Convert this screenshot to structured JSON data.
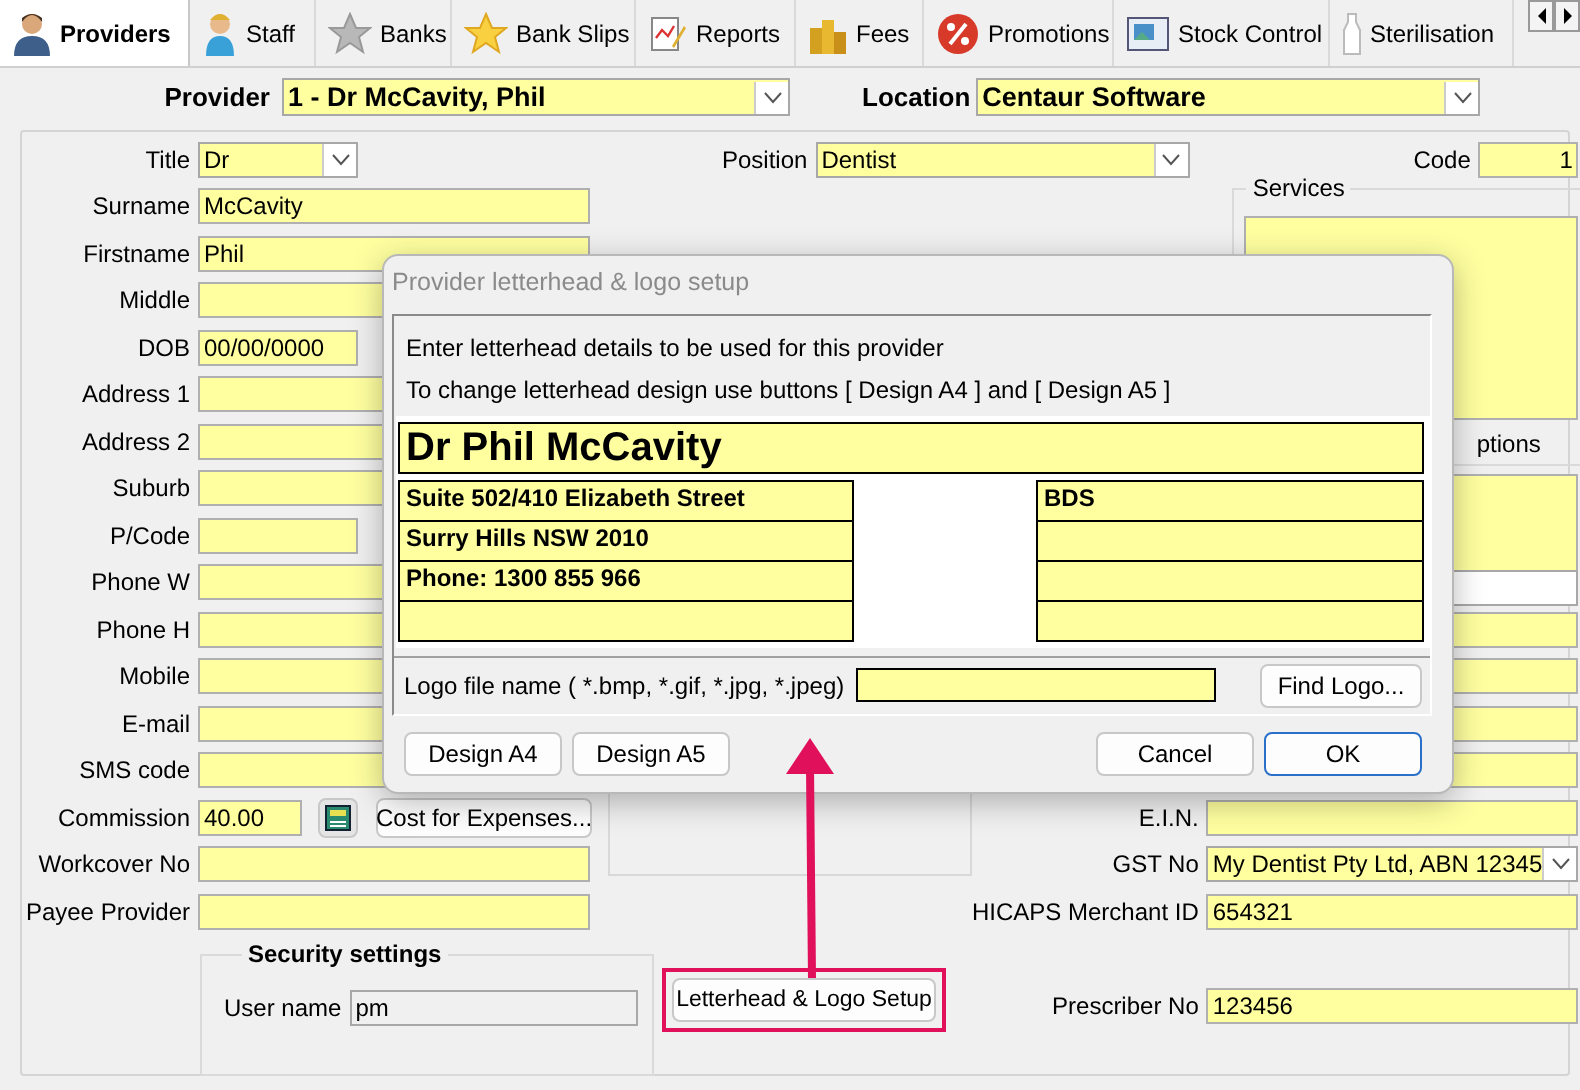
{
  "tabs": [
    {
      "label": "Providers",
      "selected": true
    },
    {
      "label": "Staff",
      "selected": false
    },
    {
      "label": "Banks",
      "selected": false
    },
    {
      "label": "Bank Slips",
      "selected": false
    },
    {
      "label": "Reports",
      "selected": false
    },
    {
      "label": "Fees",
      "selected": false
    },
    {
      "label": "Promotions",
      "selected": false
    },
    {
      "label": "Stock Control",
      "selected": false
    },
    {
      "label": "Sterilisation",
      "selected": false
    }
  ],
  "header": {
    "provider": {
      "label": "Provider",
      "value": "1 - Dr McCavity, Phil"
    },
    "location": {
      "label": "Location",
      "value": "Centaur Software"
    }
  },
  "left_fields": [
    {
      "label": "Title",
      "value": "Dr",
      "kind": "combo"
    },
    {
      "label": "Surname",
      "value": "McCavity",
      "kind": "text"
    },
    {
      "label": "Firstname",
      "value": "Phil",
      "kind": "text"
    },
    {
      "label": "Middle",
      "kind": "text"
    },
    {
      "label": "DOB",
      "value": "00/00/0000",
      "kind": "short"
    },
    {
      "label": "Address 1",
      "kind": "text"
    },
    {
      "label": "Address 2",
      "kind": "text"
    },
    {
      "label": "Suburb",
      "kind": "text"
    },
    {
      "label": "P/Code",
      "kind": "short"
    },
    {
      "label": "Phone W",
      "kind": "text"
    },
    {
      "label": "Phone H",
      "kind": "text"
    },
    {
      "label": "Mobile",
      "kind": "text"
    },
    {
      "label": "E-mail",
      "kind": "text"
    },
    {
      "label": "SMS code",
      "kind": "text"
    },
    {
      "label": "Commission",
      "value": "40.00",
      "kind": "commission",
      "button": "Cost for Expenses..."
    },
    {
      "label": "Workcover No",
      "kind": "text"
    },
    {
      "label": "Payee Provider",
      "kind": "text"
    }
  ],
  "security": {
    "title": "Security settings",
    "user_name": {
      "label": "User name",
      "value": "pm"
    }
  },
  "letterhead_button": "Letterhead & Logo Setup",
  "position": {
    "label": "Position",
    "value": "Dentist"
  },
  "code": {
    "label": "Code",
    "value": "1"
  },
  "services": {
    "title": "Services",
    "options_fragment": "ptions"
  },
  "right_fields": [
    {
      "label": "E.I.N.",
      "kind": "text"
    },
    {
      "label": "GST No",
      "value": "My Dentist Pty Ltd, ABN 12345",
      "kind": "combo"
    },
    {
      "label": "HICAPS Merchant ID",
      "value": "654321",
      "kind": "text"
    },
    {
      "label": "Prescriber No",
      "value": "123456",
      "kind": "text"
    }
  ],
  "dialog": {
    "title": "Provider letterhead & logo setup",
    "instructions": [
      "Enter letterhead details to be used for this provider",
      "To change letterhead design use buttons [ Design A4 ] and [ Design A5 ]"
    ],
    "name_line": "Dr Phil McCavity",
    "left_lines": [
      "Suite 502/410 Elizabeth Street",
      "Surry Hills NSW 2010",
      "Phone: 1300 855 966"
    ],
    "right_lines": [
      "BDS"
    ],
    "logo_label": "Logo file name ( *.bmp, *.gif, *.jpg, *.jpeg)",
    "find_button": "Find Logo...",
    "buttons": [
      {
        "label": "Design A4",
        "default": false
      },
      {
        "label": "Design A5",
        "default": false
      },
      {
        "label": "Cancel",
        "default": false
      },
      {
        "label": "OK",
        "default": true
      }
    ]
  }
}
